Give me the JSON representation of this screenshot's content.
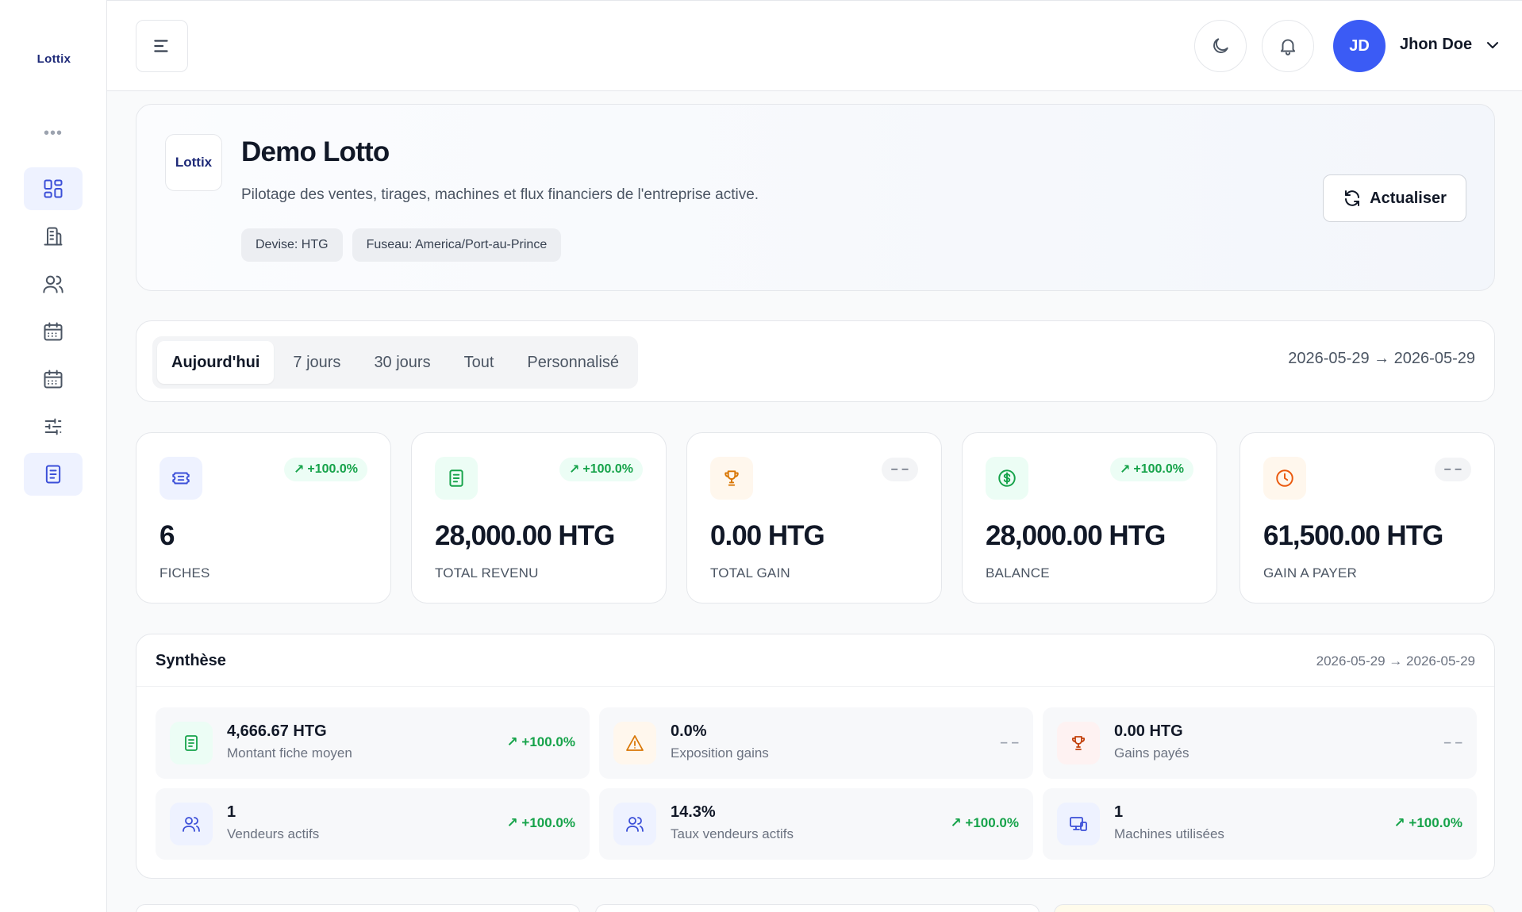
{
  "sidebar": {
    "logo": "Lottix",
    "more": "•••",
    "items": [
      {
        "name": "dashboard",
        "active": true
      },
      {
        "name": "company"
      },
      {
        "name": "users"
      },
      {
        "name": "draws"
      },
      {
        "name": "calendar"
      },
      {
        "name": "settings"
      },
      {
        "name": "reports",
        "active": true
      }
    ]
  },
  "header": {
    "avatar_initials": "JD",
    "user_name": "Jhon Doe"
  },
  "hero": {
    "logo": "Lottix",
    "title": "Demo Lotto",
    "subtitle": "Pilotage des ventes, tirages, machines et flux financiers de l'entreprise active.",
    "chips": [
      "Devise: HTG",
      "Fuseau: America/Port-au-Prince"
    ],
    "refresh_label": "Actualiser"
  },
  "period": {
    "tabs": [
      "Aujourd'hui",
      "7 jours",
      "30 jours",
      "Tout",
      "Personnalisé"
    ],
    "active_tab": "Aujourd'hui",
    "range": "2026-05-29 → 2026-05-29"
  },
  "kpis": [
    {
      "value": "6",
      "label": "FICHES",
      "badge": "+100.0%",
      "icon": "ticket-icon"
    },
    {
      "value": "28,000.00 HTG",
      "label": "TOTAL REVENU",
      "badge": "+100.0%",
      "icon": "receipt-icon"
    },
    {
      "value": "0.00 HTG",
      "label": "TOTAL GAIN",
      "badge": "– –",
      "icon": "trophy-icon"
    },
    {
      "value": "28,000.00 HTG",
      "label": "BALANCE",
      "badge": "+100.0%",
      "icon": "dollar-icon"
    },
    {
      "value": "61,500.00 HTG",
      "label": "GAIN A PAYER",
      "badge": "– –",
      "icon": "clock-icon"
    }
  ],
  "synthese": {
    "title": "Synthèse",
    "range": "2026-05-29 → 2026-05-29",
    "metrics": [
      {
        "value": "4,666.67 HTG",
        "label": "Montant fiche moyen",
        "badge": "+100.0%",
        "icon": "receipt-icon"
      },
      {
        "value": "0.0%",
        "label": "Exposition gains",
        "badge": "– –",
        "icon": "warning-icon"
      },
      {
        "value": "0.00 HTG",
        "label": "Gains payés",
        "badge": "– –",
        "icon": "trophy-icon"
      },
      {
        "value": "1",
        "label": "Vendeurs actifs",
        "badge": "+100.0%",
        "icon": "users-icon"
      },
      {
        "value": "14.3%",
        "label": "Taux vendeurs actifs",
        "badge": "+100.0%",
        "icon": "users-icon"
      },
      {
        "value": "1",
        "label": "Machines utilisées",
        "badge": "+100.0%",
        "icon": "devices-icon"
      }
    ]
  },
  "colors": {
    "accent": "#3b5bf5",
    "positive": "#16a34a",
    "neutral": "#9ca3af"
  }
}
